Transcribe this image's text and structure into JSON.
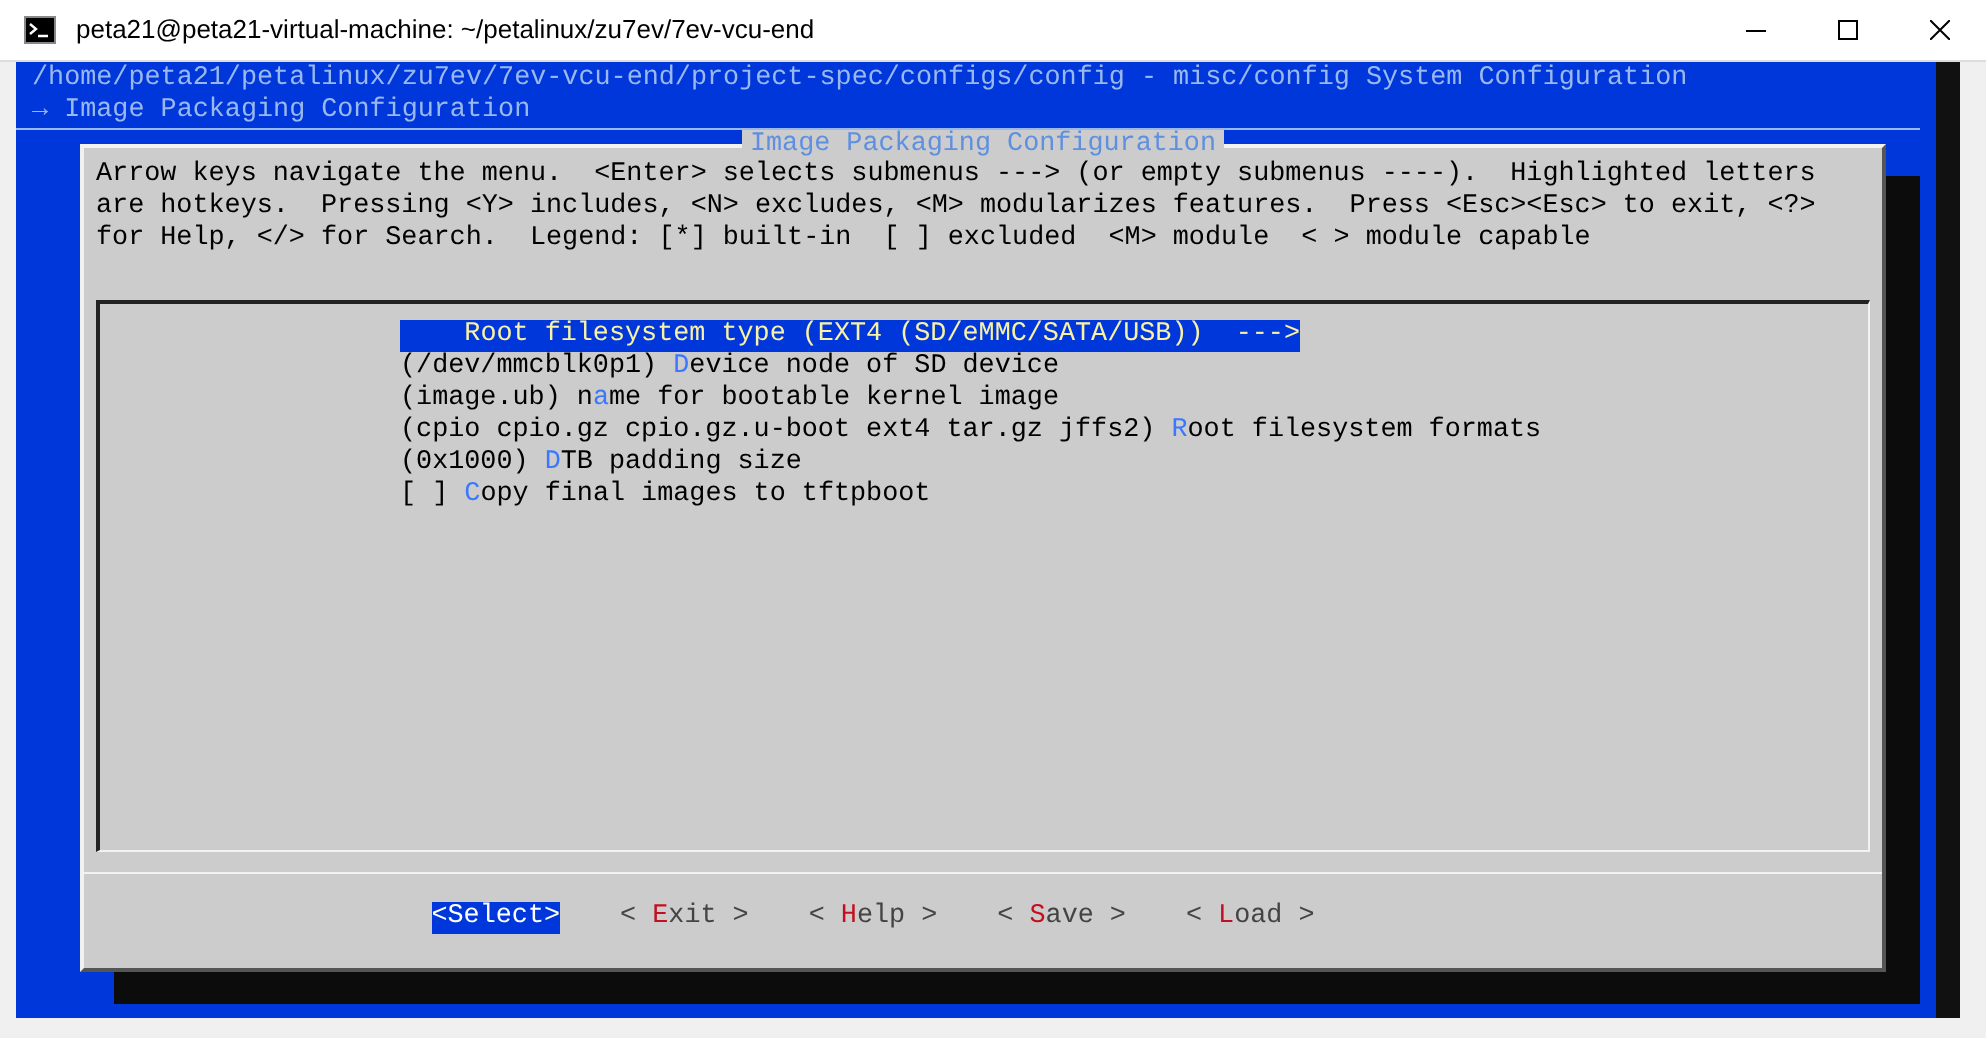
{
  "window": {
    "title": "peta21@peta21-virtual-machine: ~/petalinux/zu7ev/7ev-vcu-end"
  },
  "header": {
    "path": "/home/peta21/petalinux/zu7ev/7ev-vcu-end/project-spec/configs/config - misc/config System Configuration",
    "breadcrumb": "→ Image Packaging Configuration"
  },
  "dialog": {
    "title": "Image Packaging Configuration",
    "help_lines": [
      "Arrow keys navigate the menu.  <Enter> selects submenus ---> (or empty submenus ----).  Highlighted letters",
      "are hotkeys.  Pressing <Y> includes, <N> excludes, <M> modularizes features.  Press <Esc><Esc> to exit, <?>",
      "for Help, </> for Search.  Legend: [*] built-in  [ ] excluded  <M> module  < > module capable"
    ],
    "items": [
      {
        "hotkey": "R",
        "suffix": "oot filesystem type (EXT4 (SD/eMMC/SATA/USB))  --->",
        "selected": true
      },
      {
        "prefix": "(/dev/mmcblk0p1) ",
        "hotkey": "D",
        "suffix": "evice node of SD device",
        "selected": false
      },
      {
        "prefix": "(image.ub) n",
        "hotkey": "a",
        "suffix": "me for bootable kernel image",
        "selected": false
      },
      {
        "prefix": "(cpio cpio.gz cpio.gz.u-boot ext4 tar.gz jffs2) ",
        "hotkey": "R",
        "suffix": "oot filesystem formats",
        "selected": false
      },
      {
        "prefix": "(0x1000) ",
        "hotkey": "D",
        "suffix": "TB padding size",
        "selected": false
      },
      {
        "prefix": "[ ] ",
        "hotkey": "C",
        "suffix": "opy final images to tftpboot",
        "selected": false
      }
    ],
    "buttons": [
      {
        "left": "<",
        "hotkey": "S",
        "rest": "elect",
        "right": ">",
        "selected": true
      },
      {
        "left": "<",
        "hotkey": "E",
        "rest": "xit",
        "right": ">",
        "selected": false
      },
      {
        "left": "<",
        "hotkey": "H",
        "rest": "elp",
        "right": ">",
        "selected": false
      },
      {
        "left": "<",
        "hotkey": "S",
        "rest": "ave",
        "right": ">",
        "selected": false
      },
      {
        "left": "<",
        "hotkey": "L",
        "rest": "oad",
        "right": ">",
        "selected": false
      }
    ]
  }
}
